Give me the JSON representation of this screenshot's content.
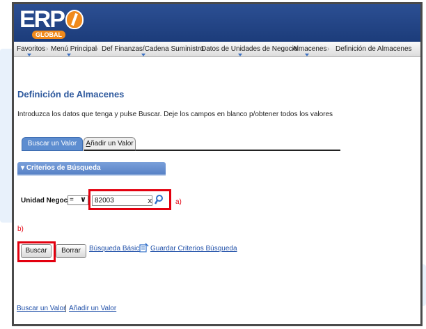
{
  "header": {
    "logo_text": "ERP",
    "logo_badge": "GLOBAL"
  },
  "nav": {
    "items": [
      "Favoritos",
      "Menú Principal",
      "Def Finanzas/Cadena Suministro",
      "Datos de Unidades de Negocio",
      "Almacenes",
      "Definición de Almacenes"
    ],
    "separator": "›"
  },
  "page": {
    "title": "Definición de Almacenes",
    "instructions": "Introduzca los datos que tenga y pulse Buscar. Deje los campos en blanco p/obtener todos los valores"
  },
  "tabs": {
    "active": "Buscar un Valor",
    "inactive_first": "A",
    "inactive_rest": "ñadir un Valor"
  },
  "search": {
    "section_title": "Criterios de Búsqueda",
    "field_label": "Unidad Negocio:",
    "operator_value": "=",
    "value": "82003",
    "clear_glyph": "x"
  },
  "buttons": {
    "search_label": "Buscar",
    "clear_label": "Borrar"
  },
  "links": {
    "basic_search": "Búsqueda Básica",
    "save_criteria": "Guardar Criterios Búsqueda",
    "footer_find": "Buscar un Valor",
    "footer_add": "Añadir un Valor",
    "footer_separator": "|"
  },
  "annotations": {
    "a": "a)",
    "b": "b)"
  },
  "colors": {
    "header_bg": "#1c3c7a",
    "accent_blue": "#5d8dd0",
    "link": "#1f4fa8",
    "highlight_red": "#e3000f",
    "logo_orange": "#f08a1c"
  }
}
